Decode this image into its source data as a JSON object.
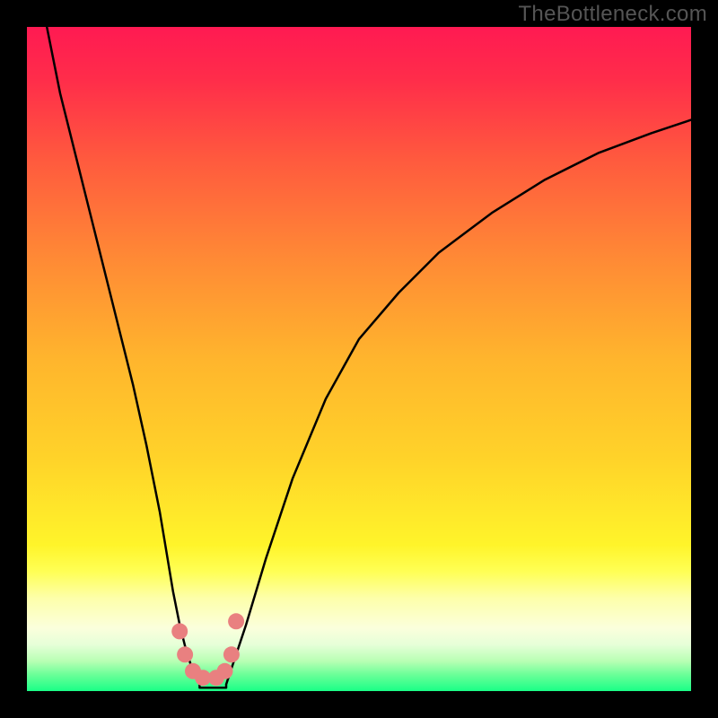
{
  "watermark": "TheBottleneck.com",
  "chart_data": {
    "type": "line",
    "title": "",
    "xlabel": "",
    "ylabel": "",
    "xlim": [
      0,
      100
    ],
    "ylim": [
      0,
      100
    ],
    "series": [
      {
        "name": "left-curve",
        "x": [
          3,
          5,
          8,
          10,
          12,
          14,
          16,
          18,
          20,
          21,
          22,
          23,
          24,
          25,
          26
        ],
        "y": [
          100,
          90,
          78,
          70,
          62,
          54,
          46,
          37,
          27,
          21,
          15,
          10,
          6,
          3,
          1
        ]
      },
      {
        "name": "right-curve",
        "x": [
          30,
          31,
          33,
          36,
          40,
          45,
          50,
          56,
          62,
          70,
          78,
          86,
          94,
          100
        ],
        "y": [
          1,
          4,
          10,
          20,
          32,
          44,
          53,
          60,
          66,
          72,
          77,
          81,
          84,
          86
        ]
      }
    ],
    "flat_band": {
      "name": "valley-floor",
      "x": [
        26,
        30
      ],
      "y": [
        0.5,
        0.5
      ]
    },
    "markers": [
      {
        "x": 23.0,
        "y": 9.0
      },
      {
        "x": 23.8,
        "y": 5.5
      },
      {
        "x": 25.0,
        "y": 3.0
      },
      {
        "x": 26.5,
        "y": 2.0
      },
      {
        "x": 28.5,
        "y": 2.0
      },
      {
        "x": 29.8,
        "y": 3.0
      },
      {
        "x": 30.8,
        "y": 5.5
      },
      {
        "x": 31.5,
        "y": 10.5
      }
    ],
    "gradient_stops": [
      {
        "offset": 0.0,
        "color": "#ff1a52"
      },
      {
        "offset": 0.08,
        "color": "#ff2d4a"
      },
      {
        "offset": 0.2,
        "color": "#ff5a3e"
      },
      {
        "offset": 0.35,
        "color": "#ff8a35"
      },
      {
        "offset": 0.5,
        "color": "#ffb52d"
      },
      {
        "offset": 0.65,
        "color": "#ffd329"
      },
      {
        "offset": 0.78,
        "color": "#fff42a"
      },
      {
        "offset": 0.82,
        "color": "#ffff55"
      },
      {
        "offset": 0.86,
        "color": "#fdffaa"
      },
      {
        "offset": 0.905,
        "color": "#fbffdc"
      },
      {
        "offset": 0.93,
        "color": "#e6ffd8"
      },
      {
        "offset": 0.955,
        "color": "#b8ffb4"
      },
      {
        "offset": 0.975,
        "color": "#6cff98"
      },
      {
        "offset": 1.0,
        "color": "#1aff87"
      }
    ],
    "marker_color": "#e98080",
    "curve_color": "#000000"
  }
}
